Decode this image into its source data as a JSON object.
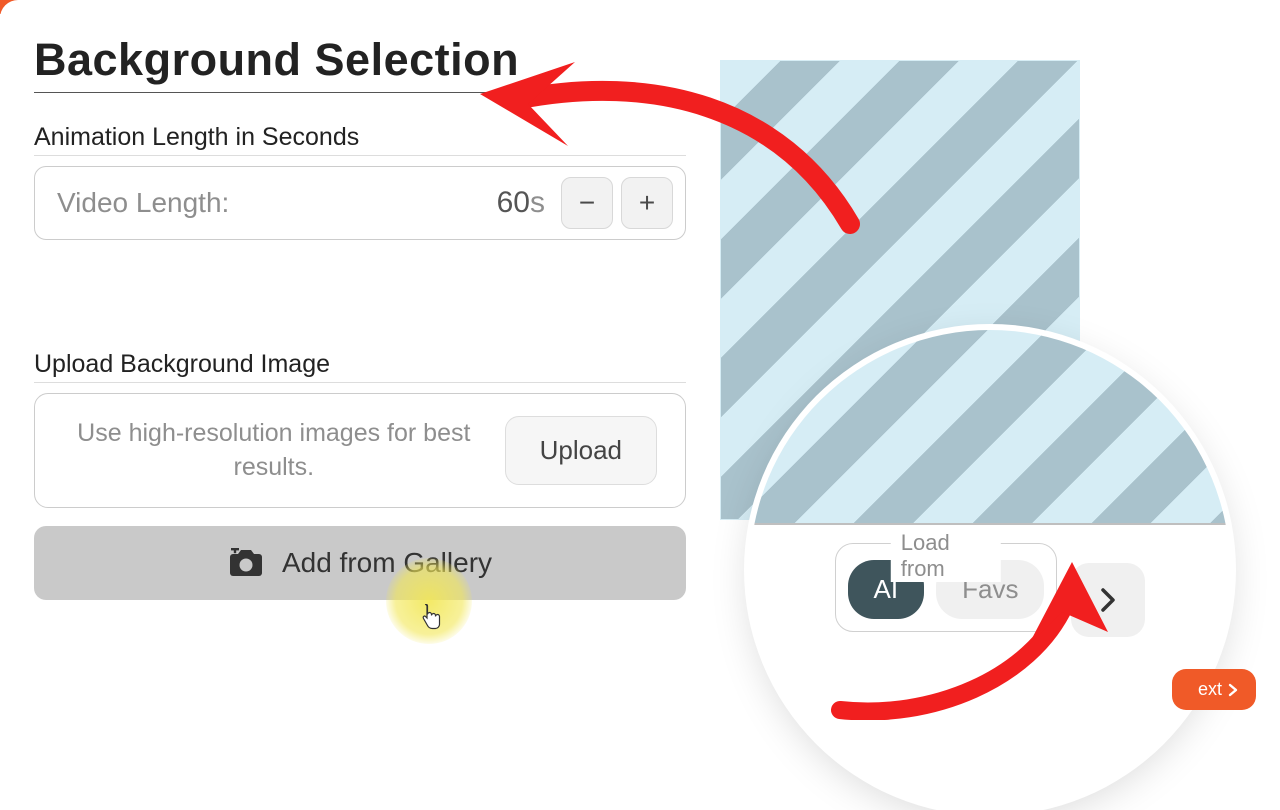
{
  "title": "Background Selection",
  "animation": {
    "section_label": "Animation Length in Seconds",
    "field_label": "Video Length:",
    "value": "60",
    "unit": "s",
    "minus": "−",
    "plus": "+"
  },
  "upload": {
    "section_label": "Upload Background Image",
    "hint": "Use high-resolution images for best results.",
    "button": "Upload"
  },
  "gallery_button": "Add from Gallery",
  "lens": {
    "legend": "Load from",
    "ai": "AI",
    "favs": "Favs"
  },
  "next_label": "ext"
}
